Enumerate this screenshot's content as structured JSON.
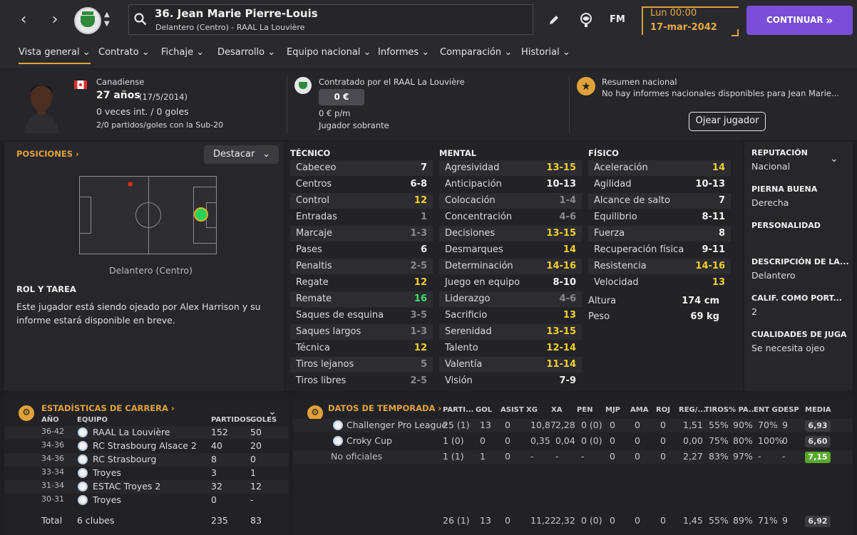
{
  "header": {
    "player_name": "36. Jean Marie Pierre-Louis",
    "player_sub": "Delantero (Centro) - RAAL La Louvière",
    "club_badge_text": "RAAL",
    "fm_label": "FM",
    "time": "Lun 00:00",
    "date": "17-mar-2042",
    "continue_label": "CONTINUAR",
    "accent": "#7a4ed8",
    "highlight": "#e2a23a"
  },
  "tabs": [
    {
      "label": "Vista general"
    },
    {
      "label": "Contrato"
    },
    {
      "label": "Fichaje"
    },
    {
      "label": "Desarrollo"
    },
    {
      "label": "Equipo nacional"
    },
    {
      "label": "Informes"
    },
    {
      "label": "Comparación"
    },
    {
      "label": "Historial"
    }
  ],
  "profile": {
    "nationality": "Canadiense",
    "age": "27 años",
    "dob": "(17/5/2014)",
    "caps": "0 veces int. / 0 goles",
    "u20": "2/0 partidos/goles con la Sub-20"
  },
  "contract": {
    "title": "Contratado por el RAAL La Louvière",
    "value": "0 €",
    "wage": "0 € p/m",
    "status": "Jugador sobrante"
  },
  "national": {
    "title": "Resumen nacional",
    "text": "No hay informes nacionales disponibles para Jean Marie...",
    "scout_button": "Ojear jugador"
  },
  "positions": {
    "title": "POSICIONES",
    "dropdown": "Destacar",
    "position_label": "Delantero (Centro)"
  },
  "role": {
    "title": "ROL Y TAREA",
    "text": "Este jugador está siendo ojeado por Alex Harrison y su informe estará disponible en breve."
  },
  "attributes": {
    "tecnico_title": "TÉCNICO",
    "mental_title": "MENTAL",
    "fisico_title": "FÍSICO",
    "tecnico": [
      {
        "name": "Cabeceo",
        "value": "7",
        "tone": "white"
      },
      {
        "name": "Centros",
        "value": "6-8",
        "tone": "white"
      },
      {
        "name": "Control",
        "value": "12",
        "tone": "yellow"
      },
      {
        "name": "Entradas",
        "value": "1",
        "tone": "grey"
      },
      {
        "name": "Marcaje",
        "value": "1-3",
        "tone": "grey"
      },
      {
        "name": "Pases",
        "value": "6",
        "tone": "white"
      },
      {
        "name": "Penaltis",
        "value": "2-5",
        "tone": "grey"
      },
      {
        "name": "Regate",
        "value": "12",
        "tone": "yellow"
      },
      {
        "name": "Remate",
        "value": "16",
        "tone": "green"
      },
      {
        "name": "Saques de esquina",
        "value": "3-5",
        "tone": "grey"
      },
      {
        "name": "Saques largos",
        "value": "1-3",
        "tone": "grey"
      },
      {
        "name": "Técnica",
        "value": "12",
        "tone": "yellow"
      },
      {
        "name": "Tiros lejanos",
        "value": "5",
        "tone": "grey"
      },
      {
        "name": "Tiros libres",
        "value": "2-5",
        "tone": "grey"
      }
    ],
    "mental": [
      {
        "name": "Agresividad",
        "value": "13-15",
        "tone": "yellow"
      },
      {
        "name": "Anticipación",
        "value": "10-13",
        "tone": "white"
      },
      {
        "name": "Colocación",
        "value": "1-4",
        "tone": "grey"
      },
      {
        "name": "Concentración",
        "value": "4-6",
        "tone": "grey"
      },
      {
        "name": "Decisiones",
        "value": "13-15",
        "tone": "yellow"
      },
      {
        "name": "Desmarques",
        "value": "14",
        "tone": "yellow"
      },
      {
        "name": "Determinación",
        "value": "14-16",
        "tone": "yellow"
      },
      {
        "name": "Juego en equipo",
        "value": "8-10",
        "tone": "white"
      },
      {
        "name": "Liderazgo",
        "value": "4-6",
        "tone": "grey"
      },
      {
        "name": "Sacrificio",
        "value": "13",
        "tone": "yellow"
      },
      {
        "name": "Serenidad",
        "value": "13-15",
        "tone": "yellow"
      },
      {
        "name": "Talento",
        "value": "12-14",
        "tone": "yellow"
      },
      {
        "name": "Valentía",
        "value": "11-14",
        "tone": "yellow"
      },
      {
        "name": "Visión",
        "value": "7-9",
        "tone": "white"
      }
    ],
    "fisico": [
      {
        "name": "Aceleración",
        "value": "14",
        "tone": "yellow"
      },
      {
        "name": "Agilidad",
        "value": "10-13",
        "tone": "white"
      },
      {
        "name": "Alcance de salto",
        "value": "7",
        "tone": "white"
      },
      {
        "name": "Equilibrio",
        "value": "8-11",
        "tone": "white"
      },
      {
        "name": "Fuerza",
        "value": "8",
        "tone": "white"
      },
      {
        "name": "Recuperación física",
        "value": "9-11",
        "tone": "white"
      },
      {
        "name": "Resistencia",
        "value": "14-16",
        "tone": "yellow"
      },
      {
        "name": "Velocidad",
        "value": "13",
        "tone": "yellow"
      }
    ],
    "height_label": "Altura",
    "height": "174 cm",
    "weight_label": "Peso",
    "weight": "69 kg"
  },
  "side": [
    {
      "title": "REPUTACIÓN",
      "value": "Nacional"
    },
    {
      "title": "PIERNA BUENA",
      "value": "Derecha"
    },
    {
      "title": "PERSONALIDAD",
      "value": ""
    },
    {
      "title": "DESCRIPCIÓN DE LA...",
      "value": "Delantero"
    },
    {
      "title": "CALIF. COMO PORT...",
      "value": "2"
    },
    {
      "title": "CUALIDADES DE JUGA",
      "value": "Se necesita ojeo"
    }
  ],
  "career": {
    "title": "ESTADÍSTICAS DE CARRERA",
    "headers": [
      "AÑO",
      "EQUIPO",
      "PARTIDOS",
      "GOLES"
    ],
    "rows": [
      {
        "year": "36-42",
        "team": "RAAL La Louvière",
        "apps": "152",
        "goals": "50"
      },
      {
        "year": "34-36",
        "team": "RC Strasbourg Alsace 2",
        "apps": "40",
        "goals": "20"
      },
      {
        "year": "34-36",
        "team": "RC Strasbourg",
        "apps": "8",
        "goals": "0"
      },
      {
        "year": "33-34",
        "team": "Troyes",
        "apps": "3",
        "goals": "1"
      },
      {
        "year": "31-34",
        "team": "ESTAC Troyes 2",
        "apps": "32",
        "goals": "12"
      },
      {
        "year": "30-31",
        "team": "Troyes",
        "apps": "0",
        "goals": "-"
      }
    ],
    "total_label": "Total",
    "total_clubs": "6 clubes",
    "total_apps": "235",
    "total_goals": "83"
  },
  "season": {
    "title": "DATOS DE TEMPORADA",
    "headers": [
      "PARTI...",
      "GOL",
      "ASIST",
      "XG",
      "XA",
      "PEN",
      "MJP",
      "AMA",
      "ROJ",
      "REG/...",
      "TIROS",
      "% PA...",
      "ENT G",
      "DESP",
      "MEDIA"
    ],
    "rows": [
      {
        "comp": "Challenger Pro League",
        "vals": [
          "25 (1)",
          "13",
          "0",
          "10,87",
          "2,28",
          "0 (0)",
          "0",
          "0",
          "0",
          "1,51",
          "55%",
          "90%",
          "70%",
          "9"
        ],
        "rating": "6,93",
        "rating_tone": "grey"
      },
      {
        "comp": "Croky Cup",
        "vals": [
          "1 (0)",
          "0",
          "0",
          "0,35",
          "0,04",
          "0 (0)",
          "0",
          "0",
          "0",
          "0,00",
          "75%",
          "80%",
          "100%",
          "0"
        ],
        "rating": "6,60",
        "rating_tone": "grey"
      },
      {
        "comp": "No oficiales",
        "vals": [
          "1 (1)",
          "1",
          "0",
          "-",
          "-",
          "-",
          "0",
          "0",
          "0",
          "2,27",
          "83%",
          "97%",
          "-",
          "-"
        ],
        "rating": "7,15",
        "rating_tone": "green"
      }
    ],
    "total": {
      "vals": [
        "26 (1)",
        "13",
        "0",
        "11,22",
        "2,32",
        "0 (0)",
        "0",
        "0",
        "0",
        "1,45",
        "55%",
        "89%",
        "71%",
        "9"
      ],
      "rating": "6,92"
    }
  }
}
